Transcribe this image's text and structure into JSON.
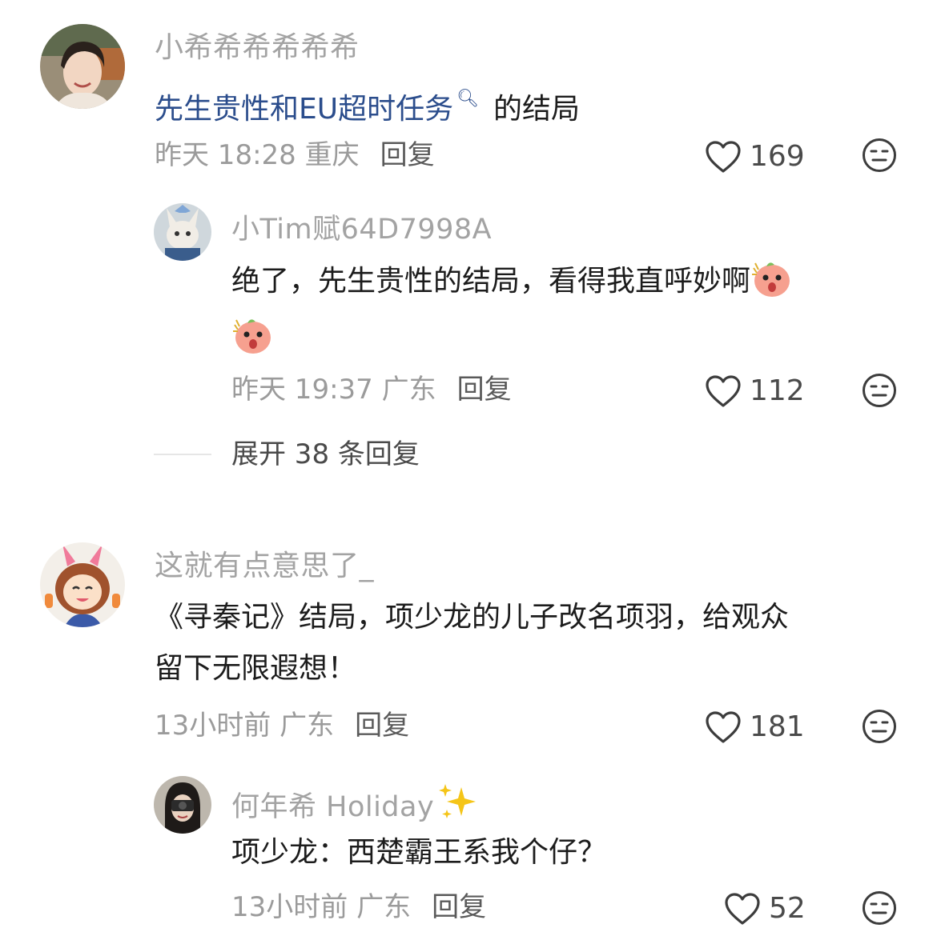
{
  "comments": [
    {
      "user": "小希希希希希希",
      "text_link": "先生贵性和EU超时任务",
      "text_rest": "的结局",
      "time": "昨天 18:28 重庆",
      "reply_label": "回复",
      "likes": "169",
      "replies": [
        {
          "user": "小Tim赋64D7998A",
          "text": "绝了，先生贵性的结局，看得我直呼妙啊",
          "time": "昨天 19:37 广东",
          "reply_label": "回复",
          "likes": "112"
        }
      ],
      "expand_label": "展开 38 条回复"
    },
    {
      "user": "这就有点意思了_",
      "text_line1": "《寻秦记》结局，项少龙的儿子改名项羽，给观众",
      "text_line2": "留下无限遐想！",
      "time": "13小时前 广东",
      "reply_label": "回复",
      "likes": "181",
      "replies": [
        {
          "user": "何年希 Holiday",
          "text": "项少龙：西楚霸王系我个仔？",
          "time": "13小时前 广东",
          "reply_label": "回复",
          "likes": "52"
        }
      ]
    }
  ],
  "icons": {
    "like": "heart-outline-icon",
    "dislike": "neutral-face-icon",
    "search_hint": "search-icon",
    "emoji": "shocked-peach-emoji",
    "sparkle": "sparkles-emoji"
  }
}
